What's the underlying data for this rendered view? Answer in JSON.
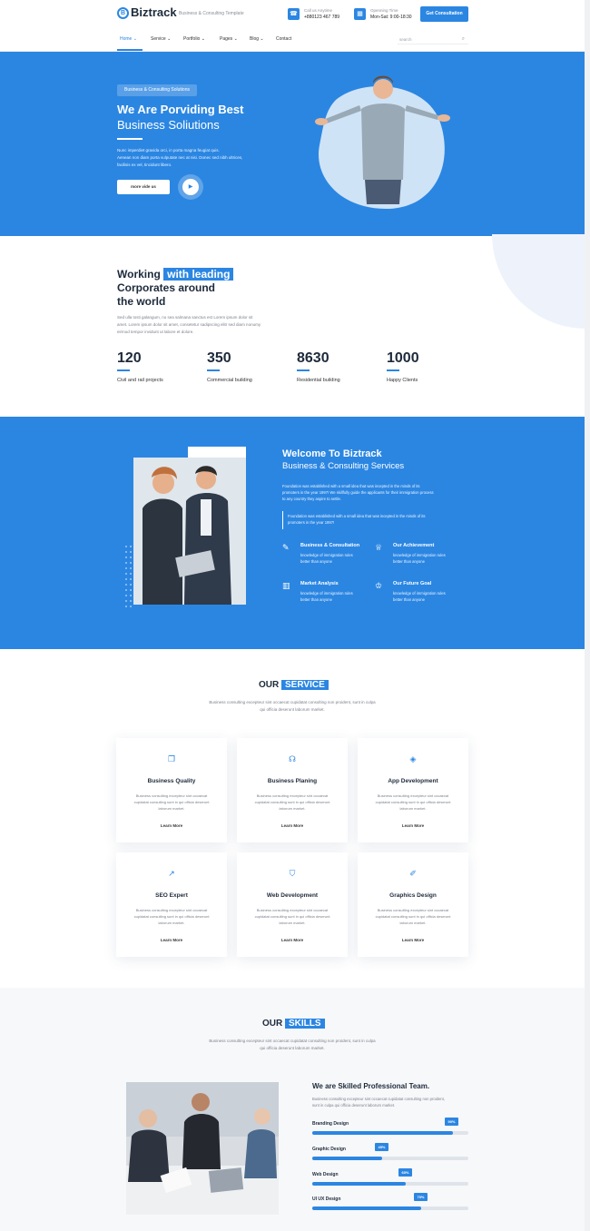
{
  "header": {
    "logo_letter": "B",
    "logo_text": "Biztrack",
    "tagline": "Business & Consulting Template",
    "call": {
      "title": "Call us Anytime",
      "value": "+880123 467 789"
    },
    "hours": {
      "title": "Openning Time",
      "value": "Mon-Sat: 9:00-18:30"
    },
    "cta_label": "Get Consultation",
    "nav": [
      {
        "label": "Home"
      },
      {
        "label": "Service"
      },
      {
        "label": "Portfolio"
      },
      {
        "label": "Pages"
      },
      {
        "label": "Blog"
      },
      {
        "label": "Contact"
      }
    ],
    "search_placeholder": "search"
  },
  "hero": {
    "pill": "Business & Consulting Solutions",
    "title": "We Are Porviding Best",
    "title2": "Business Soliutions",
    "lines": [
      "Nunc imperdiet gravida orci, in porta magna feugiat quis.",
      "Aenean non diam porta vulputate nec at nisi. Donec sed nibh ultrices,",
      "facilisis ex vel, tincidunt libero."
    ],
    "button": "more vide us",
    "play_icon": "play-icon"
  },
  "stats": {
    "title_a": "Working",
    "title_hl": "with leading",
    "title_b": "Corporates around",
    "title_c": "the world",
    "lines": [
      "Sed ulla tosti galangum, no sea salmana sanctus est Lorem ipsum dolor sit",
      "amet. Lorem ipsum dolor sit amet, consetetur sadipscing elitr sed diam nonumy",
      "eirmod tempor invidunt ut labore et dolore."
    ],
    "items": [
      {
        "value": "120",
        "label": "Civil and rail projects"
      },
      {
        "value": "350",
        "label": "Commercial building"
      },
      {
        "value": "8630",
        "label": "Residential building"
      },
      {
        "value": "1000",
        "label": "Happy Clients"
      }
    ]
  },
  "about": {
    "title": "Welcome To Biztrack",
    "subtitle": "Business & Consulting Services",
    "lines": [
      "Foundation was established with a small idea that was incepted in the minds of its",
      "promoters in the year 1997! We skillfully guide the applicants for their immigration process",
      "to any country they aspire to settle."
    ],
    "quote": [
      "Foundation was established with a small idea that was incepted in the minds of its",
      "promoters in the year 1997!"
    ],
    "features": [
      {
        "icon": "edit-icon",
        "title": "Business & Consultation",
        "d1": "knowledge of immigration rules",
        "d2": "better than anyone"
      },
      {
        "icon": "trophy-icon",
        "title": "Our Achievement",
        "d1": "knowledge of immigration rules",
        "d2": "better than anyone"
      },
      {
        "icon": "bar-chart-icon",
        "title": "Market Analysis",
        "d1": "knowledge of immigration rules",
        "d2": "better than anyone"
      },
      {
        "icon": "crown-icon",
        "title": "Our Future Goal",
        "d1": "knowledge of immigration rules",
        "d2": "better than anyone"
      }
    ]
  },
  "services": {
    "title_a": "OUR",
    "title_hl": "SERVICE",
    "sub1": "Business consulting excepteur sint occaecat cupidatat consulting non proident, sunt in culpa",
    "sub2": "qui officia deserunt laborum market.",
    "cards": [
      {
        "icon": "document-icon",
        "title": "Business Quality",
        "d1": "Business consulting excepteur sint occaecat",
        "d2": "cupidatat consulting sunt in qui officia deserunt",
        "d3": "laborum market.",
        "link": "Learn More"
      },
      {
        "icon": "headset-icon",
        "title": "Business Planing",
        "d1": "Business consulting excepteur sint occaecat",
        "d2": "cupidatat consulting sunt in qui officia deserunt",
        "d3": "laborum market.",
        "link": "Learn More"
      },
      {
        "icon": "android-icon",
        "title": "App Development",
        "d1": "Business consulting excepteur sint occaecat",
        "d2": "cupidatat consulting sunt in qui officia deserunt",
        "d3": "laborum market.",
        "link": "Learn More"
      },
      {
        "icon": "trend-icon",
        "title": "SEO Expert",
        "d1": "Business consulting excepteur sint occaecat",
        "d2": "cupidatat consulting sunt in qui officia deserunt",
        "d3": "laborum market.",
        "link": "Learn More"
      },
      {
        "icon": "html5-icon",
        "title": "Web Development",
        "d1": "Business consulting excepteur sint occaecat",
        "d2": "cupidatat consulting sunt in qui officia deserunt",
        "d3": "laborum market.",
        "link": "Learn More"
      },
      {
        "icon": "brush-icon",
        "title": "Graphics Design",
        "d1": "Business consulting excepteur sint occaecat",
        "d2": "cupidatat consulting sunt in qui officia deserunt",
        "d3": "laborum market.",
        "link": "Learn More"
      }
    ]
  },
  "skills": {
    "title_a": "OUR",
    "title_hl": "SKILLS",
    "sub1": "Business consulting excepteur sint occaecat cupidatat consulting non proident, sunt in culpa",
    "sub2": "qui officia deserunt laborum market.",
    "heading": "We are Skilled Professional Team.",
    "p1": "Business consulting excepteur sint occaecat cupidatat consulting non proident,",
    "p2": "sunt in culpa qui officia deserunt laborum market.",
    "bars": [
      {
        "label": "Branding Design",
        "percent": 90,
        "tip": "90%"
      },
      {
        "label": "Graphic Design",
        "percent": 45,
        "tip": "45%"
      },
      {
        "label": "Web Design",
        "percent": 60,
        "tip": "60%"
      },
      {
        "label": "UI UX Design",
        "percent": 70,
        "tip": "70%"
      }
    ]
  },
  "colors": {
    "accent": "#2b86e2",
    "dark": "#1d2a3b"
  }
}
